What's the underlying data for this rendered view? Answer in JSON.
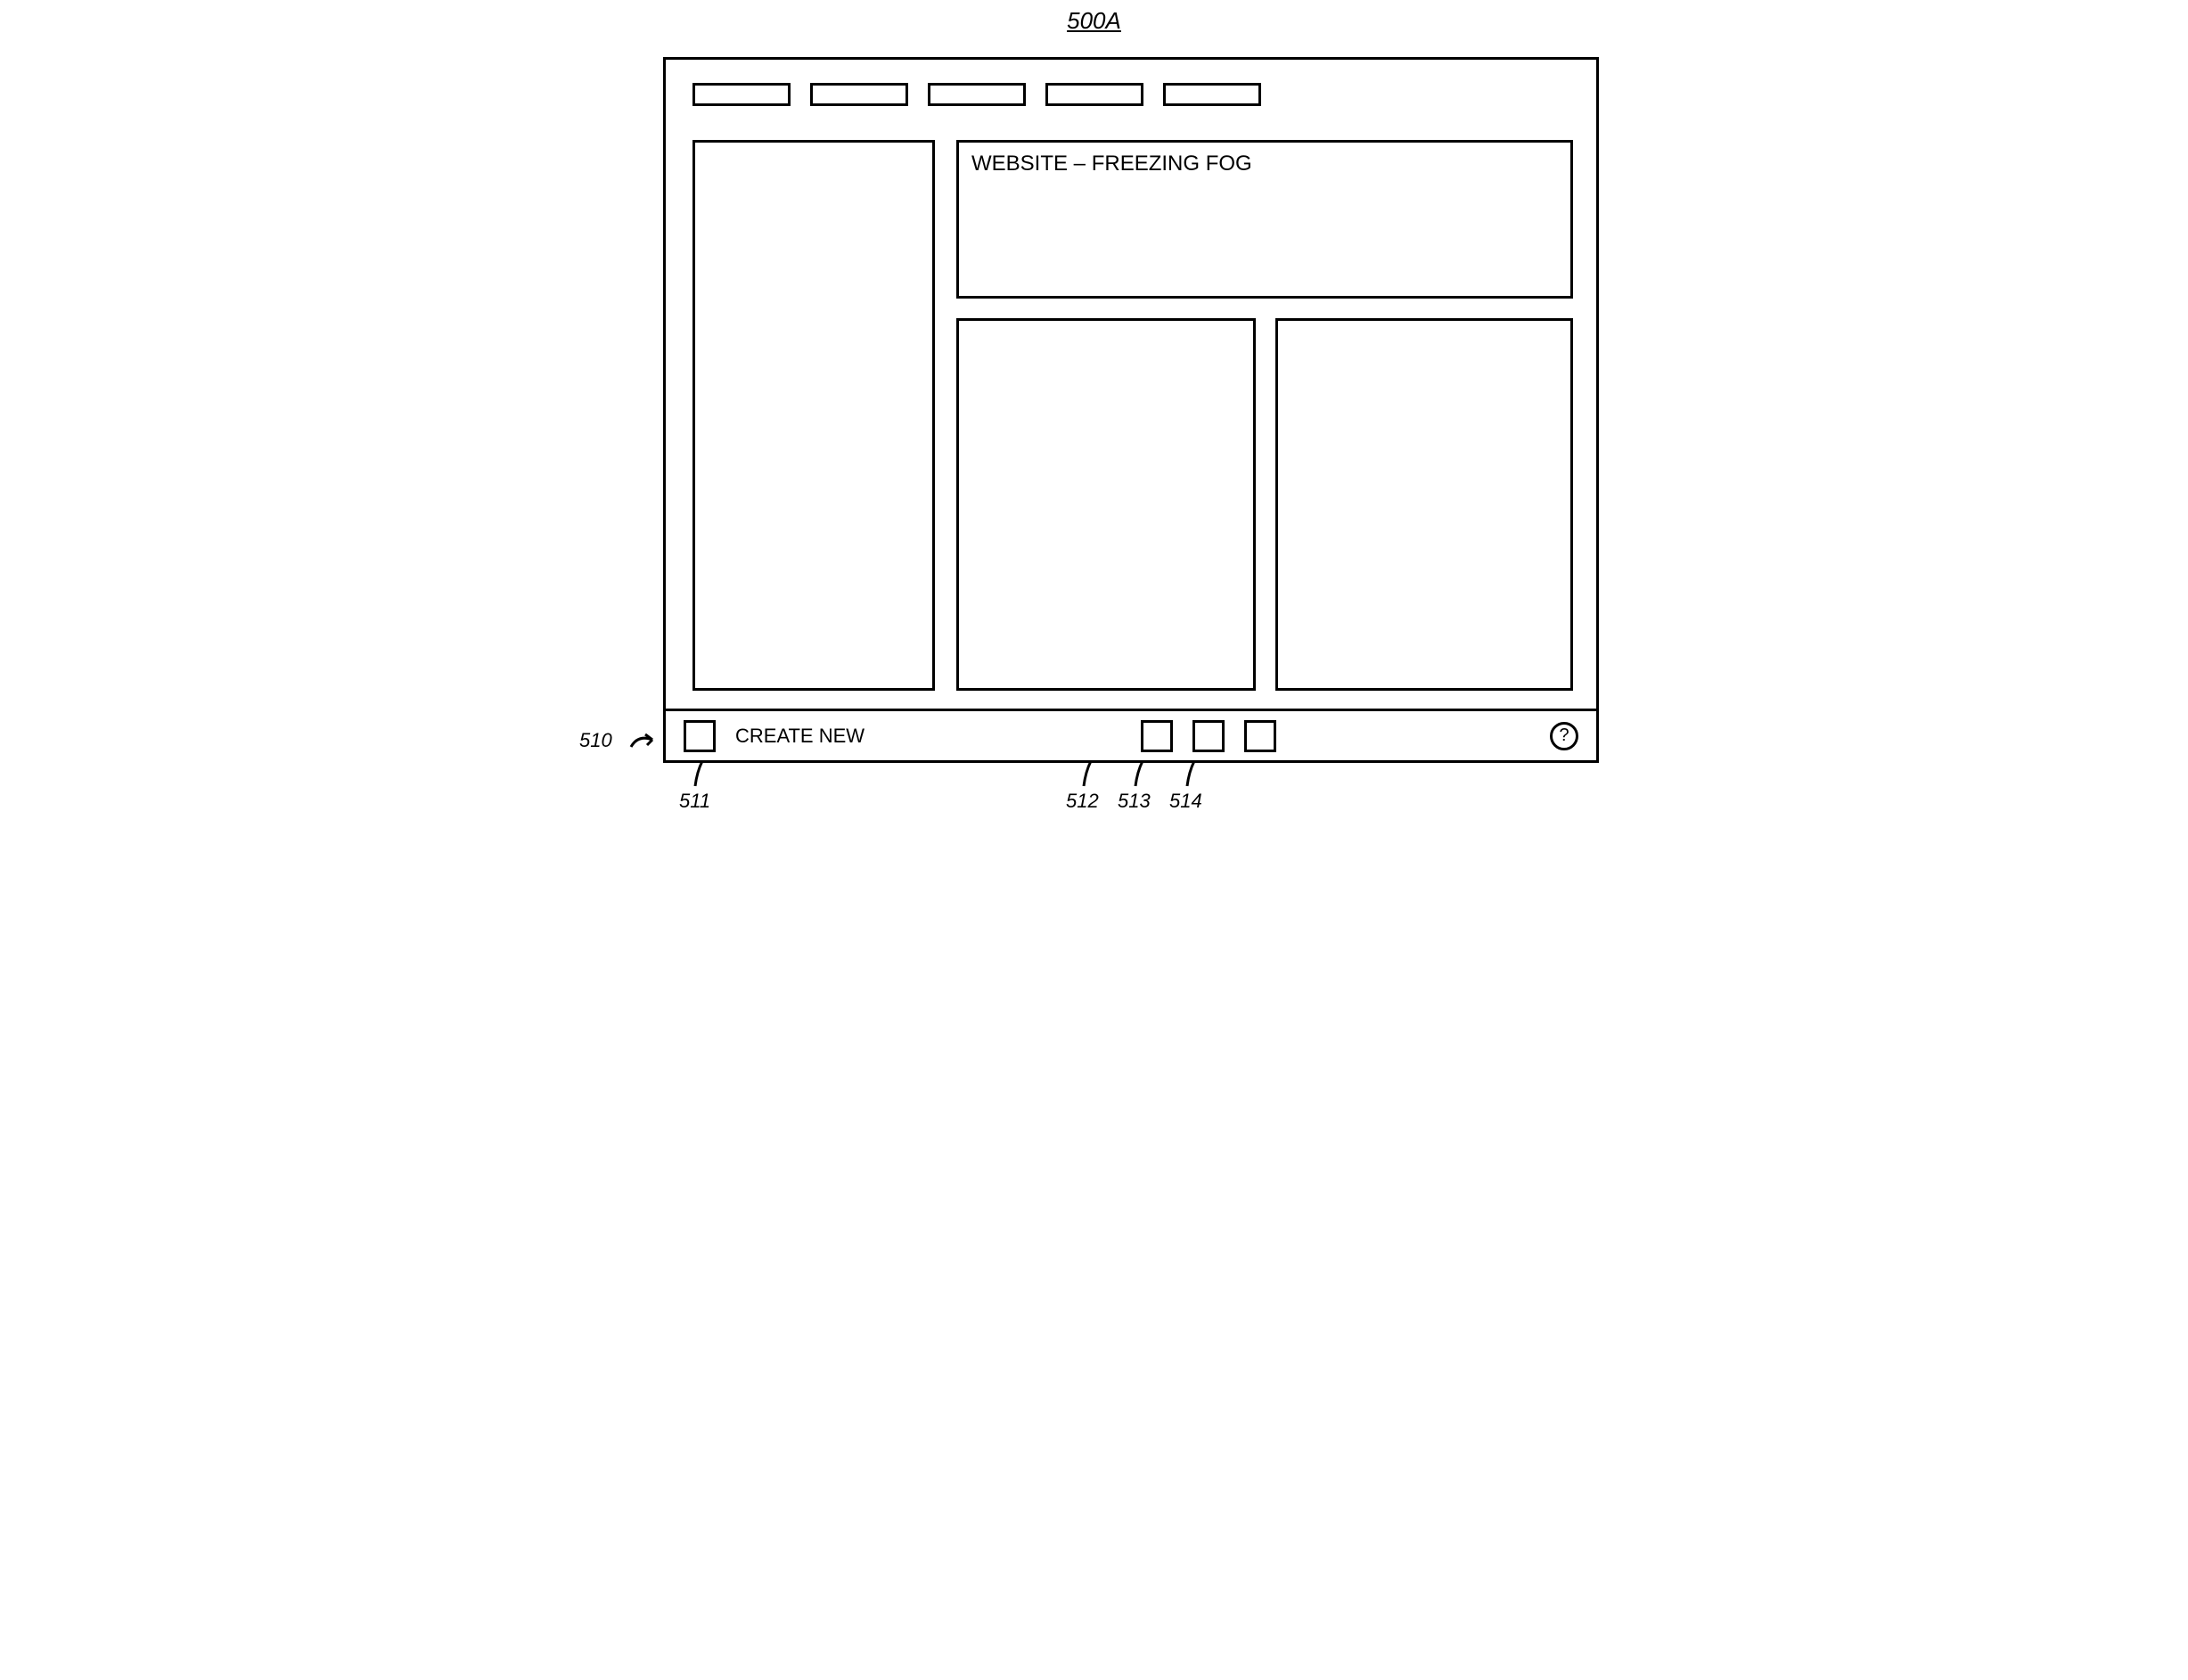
{
  "figureLabel": "500A",
  "header": {
    "title": "WEBSITE – FREEZING FOG"
  },
  "bottomBar": {
    "createNewLabel": "CREATE NEW",
    "helpGlyph": "?"
  },
  "callouts": {
    "barArrow": "510",
    "createNewSquare": "511",
    "midSquare1": "512",
    "midSquare2": "513",
    "midSquare3": "514"
  }
}
